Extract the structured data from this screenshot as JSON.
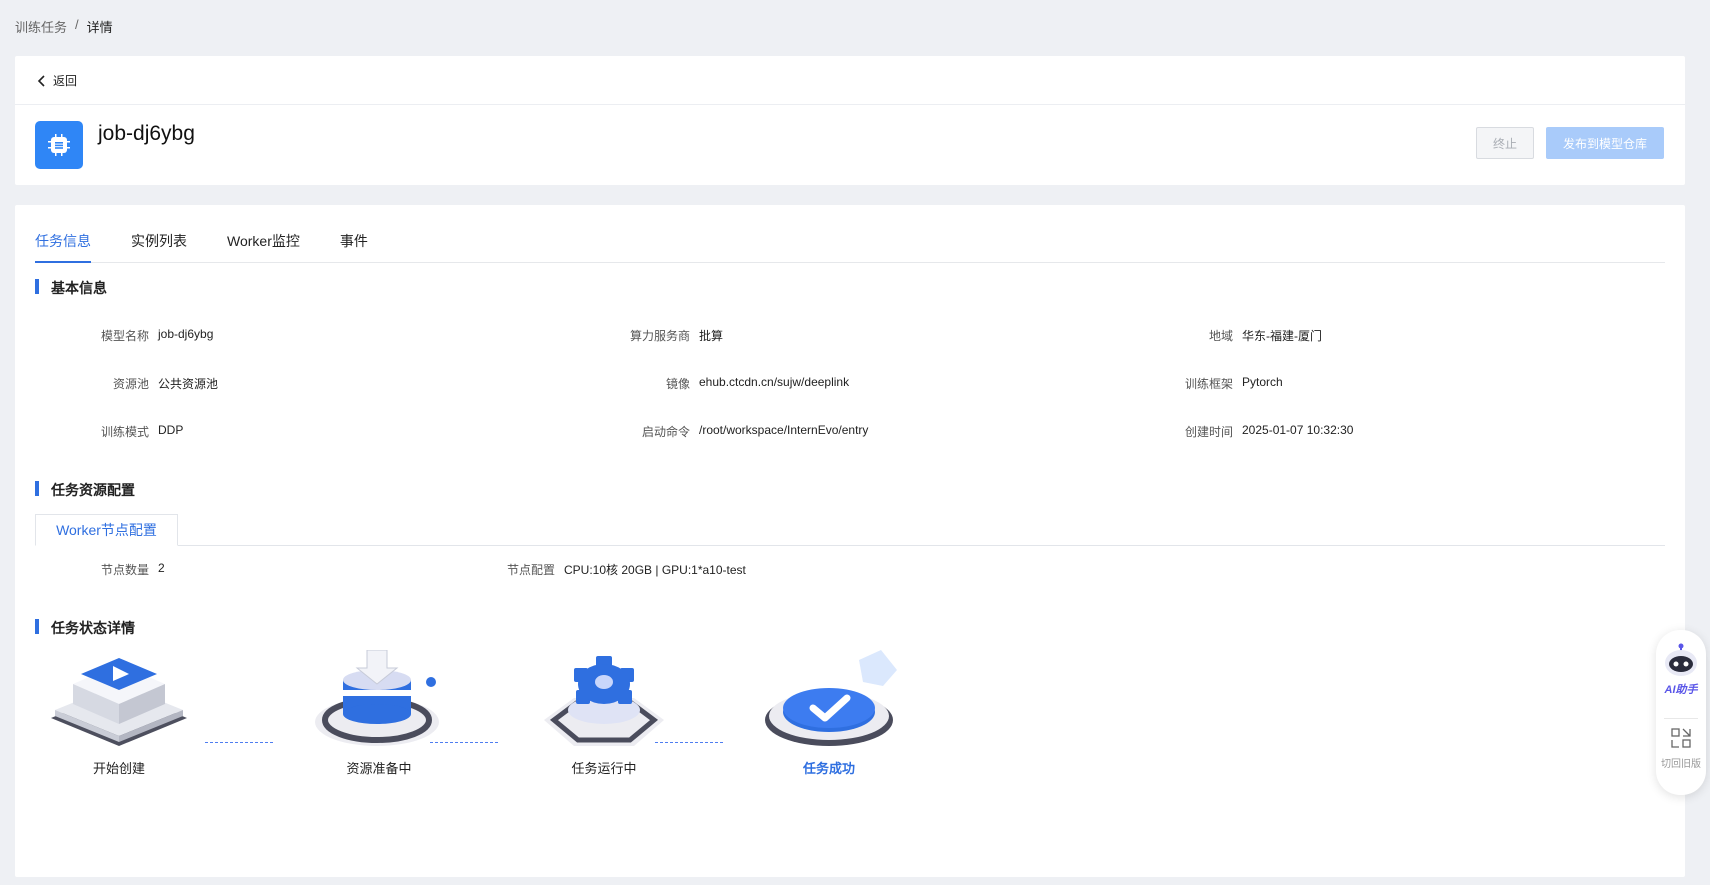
{
  "breadcrumb": {
    "parent": "训练任务",
    "separator": "/",
    "current": "详情"
  },
  "header": {
    "back_label": "返回",
    "job_name": "job-dj6ybg",
    "stop_label": "终止",
    "publish_label": "发布到模型仓库"
  },
  "tabs": [
    "任务信息",
    "实例列表",
    "Worker监控",
    "事件"
  ],
  "basic": {
    "title": "基本信息",
    "fields": [
      {
        "label": "模型名称",
        "value": "job-dj6ybg"
      },
      {
        "label": "算力服务商",
        "value": "批算"
      },
      {
        "label": "地域",
        "value": "华东-福建-厦门"
      },
      {
        "label": "资源池",
        "value": "公共资源池"
      },
      {
        "label": "镜像",
        "value": "ehub.ctcdn.cn/sujw/deeplink"
      },
      {
        "label": "训练框架",
        "value": "Pytorch"
      },
      {
        "label": "训练模式",
        "value": "DDP"
      },
      {
        "label": "启动命令",
        "value": "/root/workspace/InternEvo/entry"
      },
      {
        "label": "创建时间",
        "value": "2025-01-07 10:32:30"
      }
    ]
  },
  "resource": {
    "title": "任务资源配置",
    "subtab": "Worker节点配置",
    "node_count_label": "节点数量",
    "node_count": "2",
    "node_config_label": "节点配置",
    "node_config": "CPU:10核 20GB | GPU:1*a10-test"
  },
  "status": {
    "title": "任务状态详情",
    "steps": [
      "开始创建",
      "资源准备中",
      "任务运行中",
      "任务成功"
    ],
    "current_step": 4
  },
  "float": {
    "ai_label": "AI助手",
    "old_label": "切回旧版"
  },
  "colors": {
    "primary": "#2f6fe0",
    "icon_bg": "#2f86f6",
    "publish_disabled": "#a9cbfa"
  }
}
